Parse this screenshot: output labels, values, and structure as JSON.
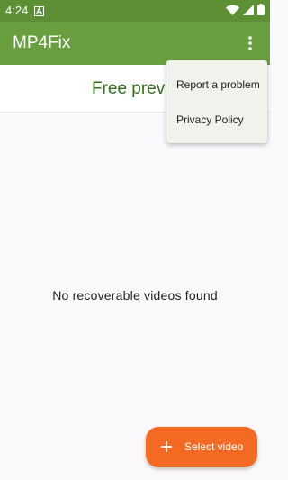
{
  "status_bar": {
    "time": "4:24",
    "icons": [
      "notification-a-icon",
      "wifi-icon",
      "signal-icon",
      "battery-icon"
    ]
  },
  "app_bar": {
    "title": "MP4Fix",
    "overflow_icon": "more-vert-icon"
  },
  "preview_banner": {
    "text": "Free previe"
  },
  "main": {
    "empty_message": "No recoverable videos found"
  },
  "overflow_menu": {
    "items": [
      {
        "label": "Report a problem"
      },
      {
        "label": "Privacy Policy"
      }
    ]
  },
  "fab": {
    "icon": "plus-icon",
    "label": "Select video"
  },
  "colors": {
    "status_bar": "#5d8f35",
    "app_bar": "#6a9f3f",
    "accent_green": "#356f1f",
    "fab": "#f46a22",
    "background": "#fcf9fd",
    "menu": "#f2f2ec"
  }
}
